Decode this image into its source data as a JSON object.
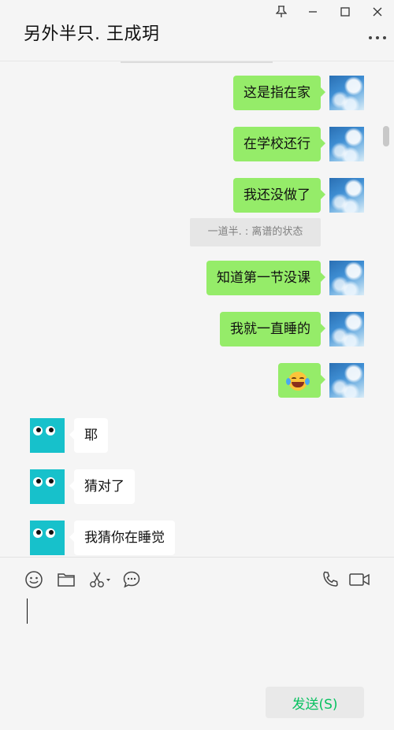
{
  "window": {
    "title": "另外半只. 王成玥"
  },
  "messages_sent": [
    {
      "text": "这是指在家"
    },
    {
      "text": "在学校还行"
    },
    {
      "text": "我还没做了"
    },
    {
      "text": "知道第一节没课"
    },
    {
      "text": "我就一直睡的"
    },
    {
      "emoji": "face-with-tears-of-joy"
    }
  ],
  "system_notice": {
    "text": "一道半. : 离谱的状态"
  },
  "messages_received": [
    {
      "text": "耶"
    },
    {
      "text": "猜对了"
    },
    {
      "text": "我猜你在睡觉"
    }
  ],
  "input": {
    "value": "",
    "send_label": "发送(S)"
  },
  "colors": {
    "sent_bubble": "#95ec69",
    "received_bubble": "#ffffff",
    "send_text": "#07c160",
    "teal_avatar": "#17c1cb"
  }
}
